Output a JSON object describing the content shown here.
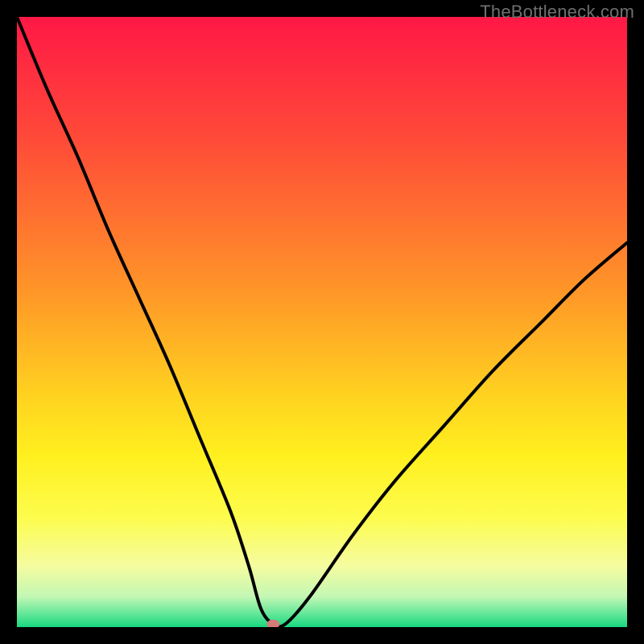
{
  "watermark": "TheBottleneck.com",
  "chart_data": {
    "type": "line",
    "title": "",
    "xlabel": "",
    "ylabel": "",
    "xlim": [
      0,
      100
    ],
    "ylim": [
      0,
      100
    ],
    "minimum_x": 42,
    "marker": {
      "x": 42,
      "y": 0.5,
      "color": "#d57b79"
    },
    "series": [
      {
        "name": "curve",
        "x": [
          0,
          5,
          10,
          15,
          20,
          25,
          30,
          35,
          38,
          40,
          42,
          44,
          48,
          55,
          62,
          70,
          78,
          86,
          93,
          100
        ],
        "y": [
          100,
          88,
          77,
          65,
          54,
          43,
          31,
          19,
          10,
          3,
          0.5,
          0.5,
          5,
          15,
          24,
          33,
          42,
          50,
          57,
          63
        ]
      }
    ],
    "gradient_stops": [
      {
        "offset": 0,
        "color": "#ff1846"
      },
      {
        "offset": 0.2,
        "color": "#ff4a38"
      },
      {
        "offset": 0.45,
        "color": "#ff9628"
      },
      {
        "offset": 0.62,
        "color": "#ffd220"
      },
      {
        "offset": 0.72,
        "color": "#fff01f"
      },
      {
        "offset": 0.82,
        "color": "#fdfc4d"
      },
      {
        "offset": 0.9,
        "color": "#f5fca0"
      },
      {
        "offset": 0.95,
        "color": "#c3f7b4"
      },
      {
        "offset": 0.975,
        "color": "#6ee99c"
      },
      {
        "offset": 1.0,
        "color": "#18d880"
      }
    ]
  }
}
